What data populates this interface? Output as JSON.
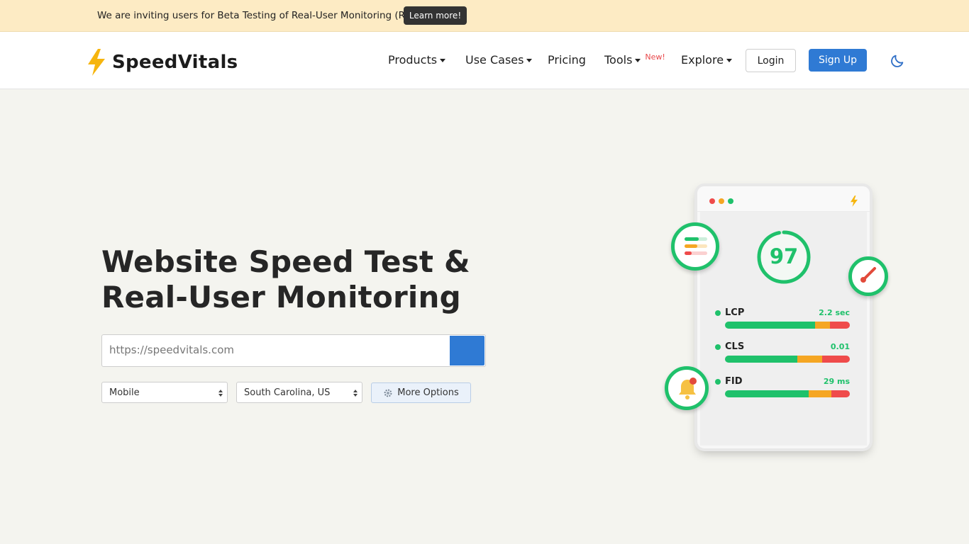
{
  "announcement": {
    "text": "We are inviting users for Beta Testing of Real-User Monitoring (RUM)",
    "button_label": "Learn more!"
  },
  "header": {
    "logo_text": "SpeedVitals",
    "nav": [
      {
        "label": "Products",
        "dropdown": true
      },
      {
        "label": "Use Cases",
        "dropdown": true
      },
      {
        "label": "Pricing",
        "dropdown": false
      },
      {
        "label": "Tools",
        "dropdown": true,
        "badge": "New!"
      },
      {
        "label": "Explore",
        "dropdown": true
      }
    ],
    "login_label": "Login",
    "signup_label": "Sign Up",
    "theme_icon": "moon-icon"
  },
  "hero": {
    "title_line1": "Website Speed Test &",
    "title_line2": "Real-User Monitoring",
    "url_placeholder": "https://speedvitals.com",
    "device_select": "Mobile",
    "location_select": "South Carolina, US",
    "more_options_label": "More Options"
  },
  "illustration": {
    "score": "97",
    "metrics": [
      {
        "name": "LCP",
        "value": "2.2 sec",
        "good": 0.72,
        "needs_improvement": 0.12,
        "poor": 0.16
      },
      {
        "name": "CLS",
        "value": "0.01",
        "good": 0.58,
        "needs_improvement": 0.2,
        "poor": 0.22
      },
      {
        "name": "FID",
        "value": "29 ms",
        "good": 0.67,
        "needs_improvement": 0.18,
        "poor": 0.15
      }
    ]
  },
  "colors": {
    "accent": "#2f7ad4",
    "banner": "#fdebc4",
    "good": "#1fc16b",
    "warn": "#f5a623",
    "bad": "#ef4b4b",
    "new_badge": "#e8484b"
  }
}
